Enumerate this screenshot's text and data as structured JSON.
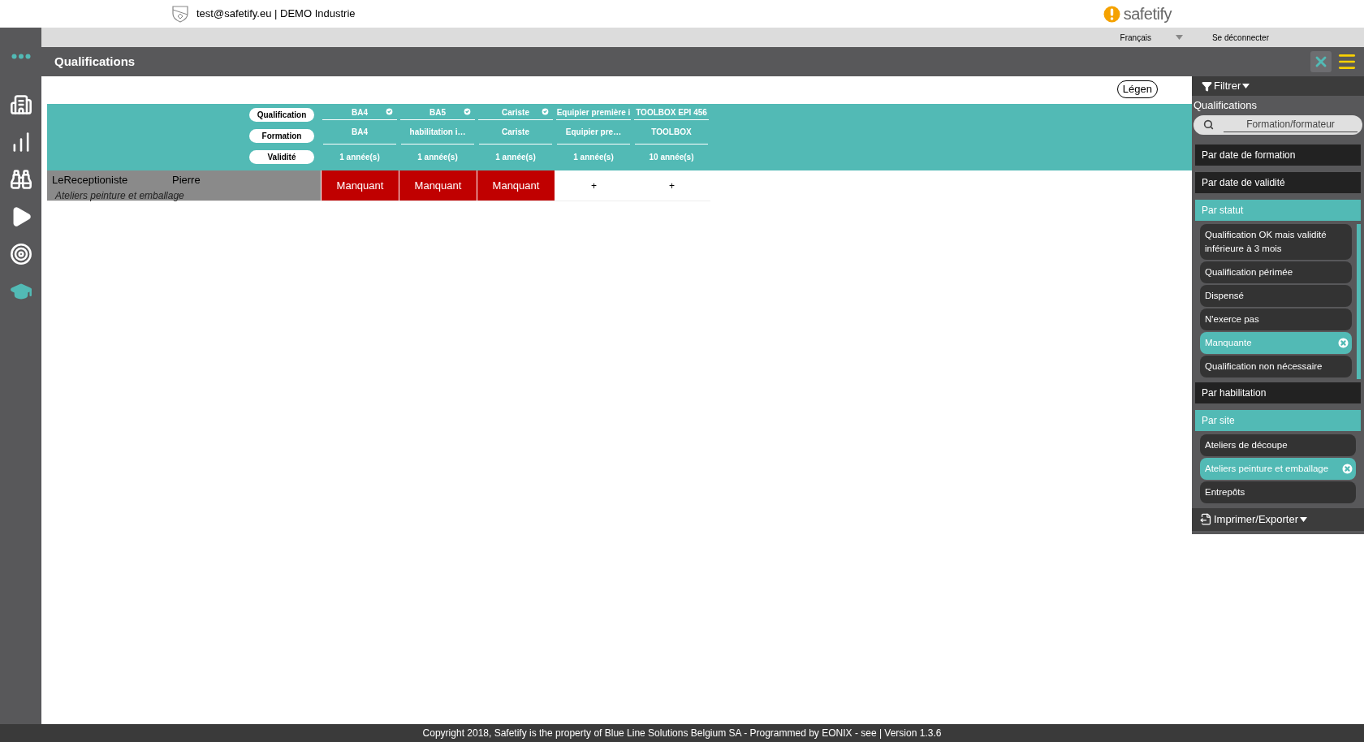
{
  "header": {
    "account": "test@safetify.eu | DEMO Industrie",
    "brand": "safetify"
  },
  "topbar": {
    "language": "Français",
    "logout": "Se déconnecter"
  },
  "title_bar": {
    "title": "Qualifications"
  },
  "nav_items": [
    {
      "kind": "buildings",
      "selected": false
    },
    {
      "kind": "chart",
      "selected": false
    },
    {
      "kind": "binoculars",
      "selected": false
    },
    {
      "kind": "play",
      "selected": false
    },
    {
      "kind": "target",
      "selected": false
    },
    {
      "kind": "graduation",
      "selected": true
    }
  ],
  "legend_button": "Légen",
  "table": {
    "row_labels": [
      "Qualification",
      "Formation",
      "Validité"
    ],
    "columns": [
      {
        "qualification": "BA4",
        "validated": true,
        "formation": "BA4",
        "validity": "1 année(s)"
      },
      {
        "qualification": "BA5",
        "validated": true,
        "formation": "habilitation i…",
        "validity": "1 année(s)"
      },
      {
        "qualification": "Cariste",
        "validated": true,
        "formation": "Cariste",
        "validity": "1 année(s)"
      },
      {
        "qualification": "Equipier première i",
        "validated": false,
        "formation": "Equipier pre…",
        "validity": "1 année(s)"
      },
      {
        "qualification": "TOOLBOX EPI 456",
        "validated": false,
        "formation": "TOOLBOX",
        "validity": "10 année(s)"
      }
    ],
    "rows": [
      {
        "last_name": "LeReceptioniste",
        "first_name": "Pierre",
        "site": "Ateliers peinture et emballage",
        "cells": [
          {
            "kind": "missing",
            "text": "Manquant"
          },
          {
            "kind": "missing",
            "text": "Manquant"
          },
          {
            "kind": "missing",
            "text": "Manquant"
          },
          {
            "kind": "add",
            "text": "+"
          },
          {
            "kind": "add",
            "text": "+"
          }
        ]
      }
    ]
  },
  "filter_panel": {
    "filter_label": "Filtrer",
    "section": "Qualifications",
    "search": {
      "placeholder": "Formation/formateur"
    },
    "groups": [
      {
        "label": "Par date de formation",
        "expanded": false
      },
      {
        "label": "Par date de validité",
        "expanded": false
      },
      {
        "label": "Par statut",
        "expanded": true,
        "scrollable": true,
        "options": [
          {
            "label": "Qualification OK mais validité inférieure à 3 mois",
            "selected": false
          },
          {
            "label": "Qualification périmée",
            "selected": false
          },
          {
            "label": "Dispensé",
            "selected": false
          },
          {
            "label": "N'exerce pas",
            "selected": false
          },
          {
            "label": "Manquante",
            "selected": true
          },
          {
            "label": "Qualification non nécessaire",
            "selected": false
          }
        ]
      },
      {
        "label": "Par habilitation",
        "expanded": false
      },
      {
        "label": "Par site",
        "expanded": true,
        "scrollable": false,
        "options": [
          {
            "label": "Ateliers de découpe",
            "selected": false
          },
          {
            "label": "Ateliers peinture et emballage",
            "selected": true
          },
          {
            "label": "Entrepôts",
            "selected": false
          }
        ]
      }
    ],
    "export_label": "Imprimer/Exporter"
  },
  "footer": "Copyright 2018, Safetify is the property of Blue Line Solutions Belgium SA - Programmed by EONIX - see | Version 1.3.6"
}
